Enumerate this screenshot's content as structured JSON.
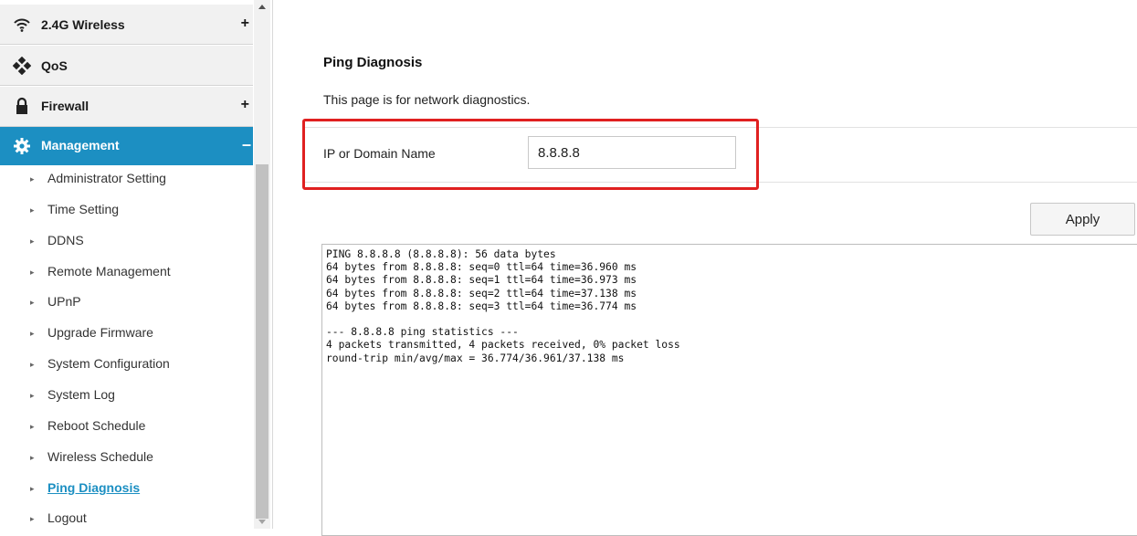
{
  "sidebar": {
    "menus": [
      {
        "label": "2.4G Wireless",
        "sign": "+",
        "icon": "wifi-icon"
      },
      {
        "label": "QoS",
        "sign": "",
        "icon": "qos-icon"
      },
      {
        "label": "Firewall",
        "sign": "+",
        "icon": "lock-icon"
      },
      {
        "label": "Management",
        "sign": "–",
        "icon": "gear-icon"
      }
    ],
    "items": [
      {
        "label": "Administrator Setting"
      },
      {
        "label": "Time Setting"
      },
      {
        "label": "DDNS"
      },
      {
        "label": "Remote Management"
      },
      {
        "label": "UPnP"
      },
      {
        "label": "Upgrade Firmware"
      },
      {
        "label": "System Configuration"
      },
      {
        "label": "System Log"
      },
      {
        "label": "Reboot Schedule"
      },
      {
        "label": "Wireless Schedule"
      },
      {
        "label": "Ping Diagnosis"
      },
      {
        "label": "Logout"
      }
    ],
    "arrow_glyph": "▸"
  },
  "main": {
    "title": "Ping Diagnosis",
    "description": "This page is for network diagnostics.",
    "field_label": "IP or Domain Name",
    "ip_value": "8.8.8.8",
    "apply_label": "Apply",
    "output_text": "PING 8.8.8.8 (8.8.8.8): 56 data bytes\n64 bytes from 8.8.8.8: seq=0 ttl=64 time=36.960 ms\n64 bytes from 8.8.8.8: seq=1 ttl=64 time=36.973 ms\n64 bytes from 8.8.8.8: seq=2 ttl=64 time=37.138 ms\n64 bytes from 8.8.8.8: seq=3 ttl=64 time=36.774 ms\n\n--- 8.8.8.8 ping statistics ---\n4 packets transmitted, 4 packets received, 0% packet loss\nround-trip min/avg/max = 36.774/36.961/37.138 ms"
  },
  "colors": {
    "accent": "#1c8fc2",
    "highlight_border": "#e02020",
    "menu_bg": "#f1f1f1"
  }
}
